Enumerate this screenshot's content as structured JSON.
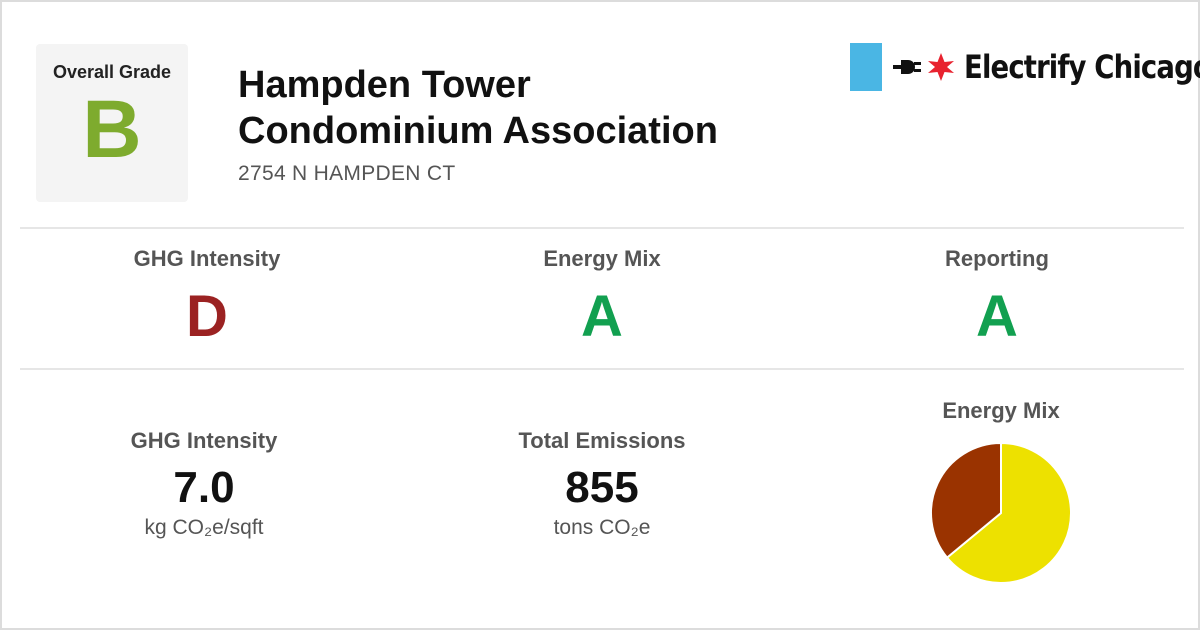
{
  "overall": {
    "label": "Overall Grade",
    "grade": "B",
    "grade_color": "#7eab2e"
  },
  "building": {
    "name_line1": "Hampden Tower",
    "name_line2": "Condominium Association",
    "address": "2754 N HAMPDEN CT"
  },
  "brand": {
    "text": "Electrify Chicago",
    "stripe_color": "#4ab6e4",
    "star_color": "#e8222f",
    "icons": [
      "flag-stripe-icon",
      "plug-icon",
      "chicago-star-icon"
    ]
  },
  "grades": [
    {
      "title": "GHG Intensity",
      "grade": "D",
      "color": "#9b2222"
    },
    {
      "title": "Energy Mix",
      "grade": "A",
      "color": "#12a050"
    },
    {
      "title": "Reporting",
      "grade": "A",
      "color": "#12a050"
    }
  ],
  "metrics": {
    "ghg": {
      "title": "GHG Intensity",
      "value": "7.0",
      "unit": "kg CO₂e/sqft"
    },
    "emissions": {
      "title": "Total Emissions",
      "value": "855",
      "unit": "tons CO₂e"
    }
  },
  "energy_mix": {
    "title": "Energy Mix",
    "chart_data": {
      "type": "pie",
      "slices": [
        {
          "value": 0.64,
          "color": "#ede100"
        },
        {
          "value": 0.36,
          "color": "#9a3300"
        }
      ]
    }
  }
}
